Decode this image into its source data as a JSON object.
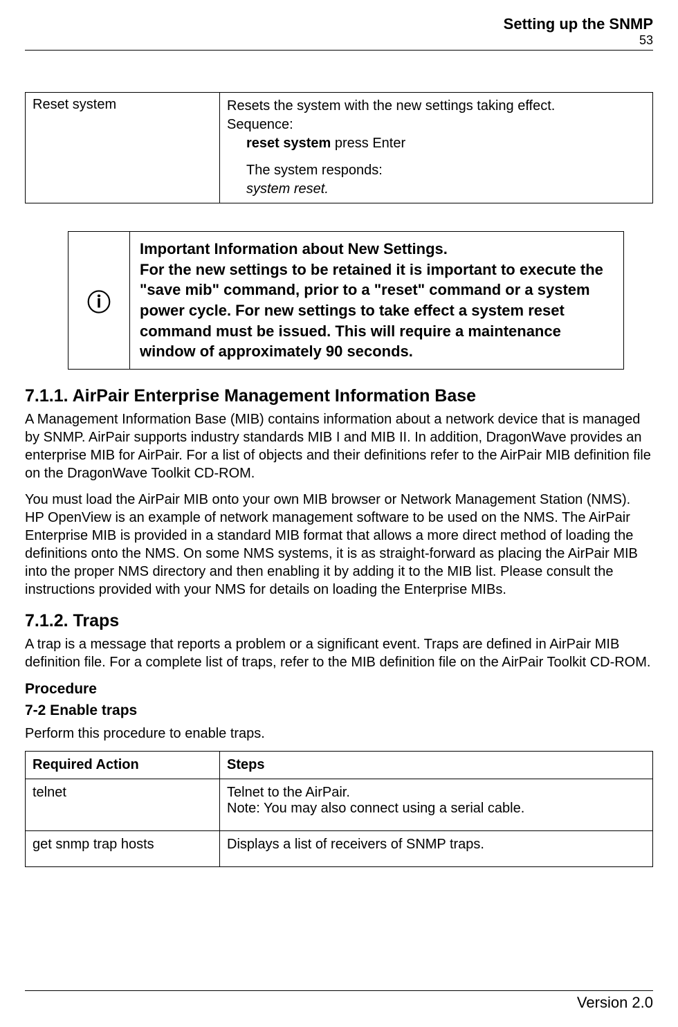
{
  "header": {
    "title": "Setting up the SNMP",
    "page_no": "53"
  },
  "table1": {
    "rows": [
      {
        "action": "Reset system",
        "desc_line1": "Resets the system with the new settings taking effect.",
        "sequence_label": "Sequence:",
        "cmd_bold": "reset system",
        "cmd_rest": " press Enter",
        "resp_intro": "The system responds:",
        "resp_italic": "system reset."
      }
    ]
  },
  "callout": {
    "icon": "ⓘ",
    "title": "Important Information about New Settings.",
    "body": "For the new settings to be retained it is important to execute the \"save mib\" command, prior to a \"reset\" command or a system power cycle. For new settings to take effect a system reset command must be issued. This will require a maintenance window of approximately 90 seconds."
  },
  "section1": {
    "heading": "7.1.1. AirPair Enterprise Management Information Base",
    "para1": "A Management Information Base (MIB) contains information about a network device that is managed by SNMP. AirPair supports industry standards MIB I and MIB II. In addition, DragonWave provides an enterprise MIB for AirPair. For a list of objects and their definitions refer to the AirPair MIB definition file on the DragonWave Toolkit CD-ROM.",
    "para2": "You must load the AirPair MIB onto your own MIB browser or Network Management Station (NMS). HP OpenView is an example of network management software to be used on the NMS. The AirPair Enterprise MIB is provided in a standard MIB format that allows a more direct method of loading the definitions onto the NMS. On some NMS systems, it is as straight-forward as placing the AirPair MIB into the proper NMS directory and then enabling it by adding it to the MIB list.  Please consult the instructions provided with your NMS for details on loading the Enterprise MIBs."
  },
  "section2": {
    "heading": "7.1.2. Traps",
    "para1": "A trap is a message that reports a problem or a significant event. Traps are defined in AirPair MIB definition file. For a complete list of traps, refer to the MIB definition file on the AirPair Toolkit CD-ROM.",
    "procedure_label": "Procedure",
    "procedure_num": "7-2 Enable traps",
    "instruction": "Perform this procedure to enable traps."
  },
  "steps_table": {
    "header": {
      "col1": "Required Action",
      "col2": "Steps"
    },
    "rows": [
      {
        "action": "telnet",
        "line1": "Telnet to the AirPair.",
        "line2": "Note: You may also connect using a serial cable."
      },
      {
        "action": "get snmp trap hosts",
        "line1": "Displays a list of receivers of SNMP traps.",
        "line2": ""
      }
    ]
  },
  "footer": {
    "version": "Version 2.0"
  }
}
